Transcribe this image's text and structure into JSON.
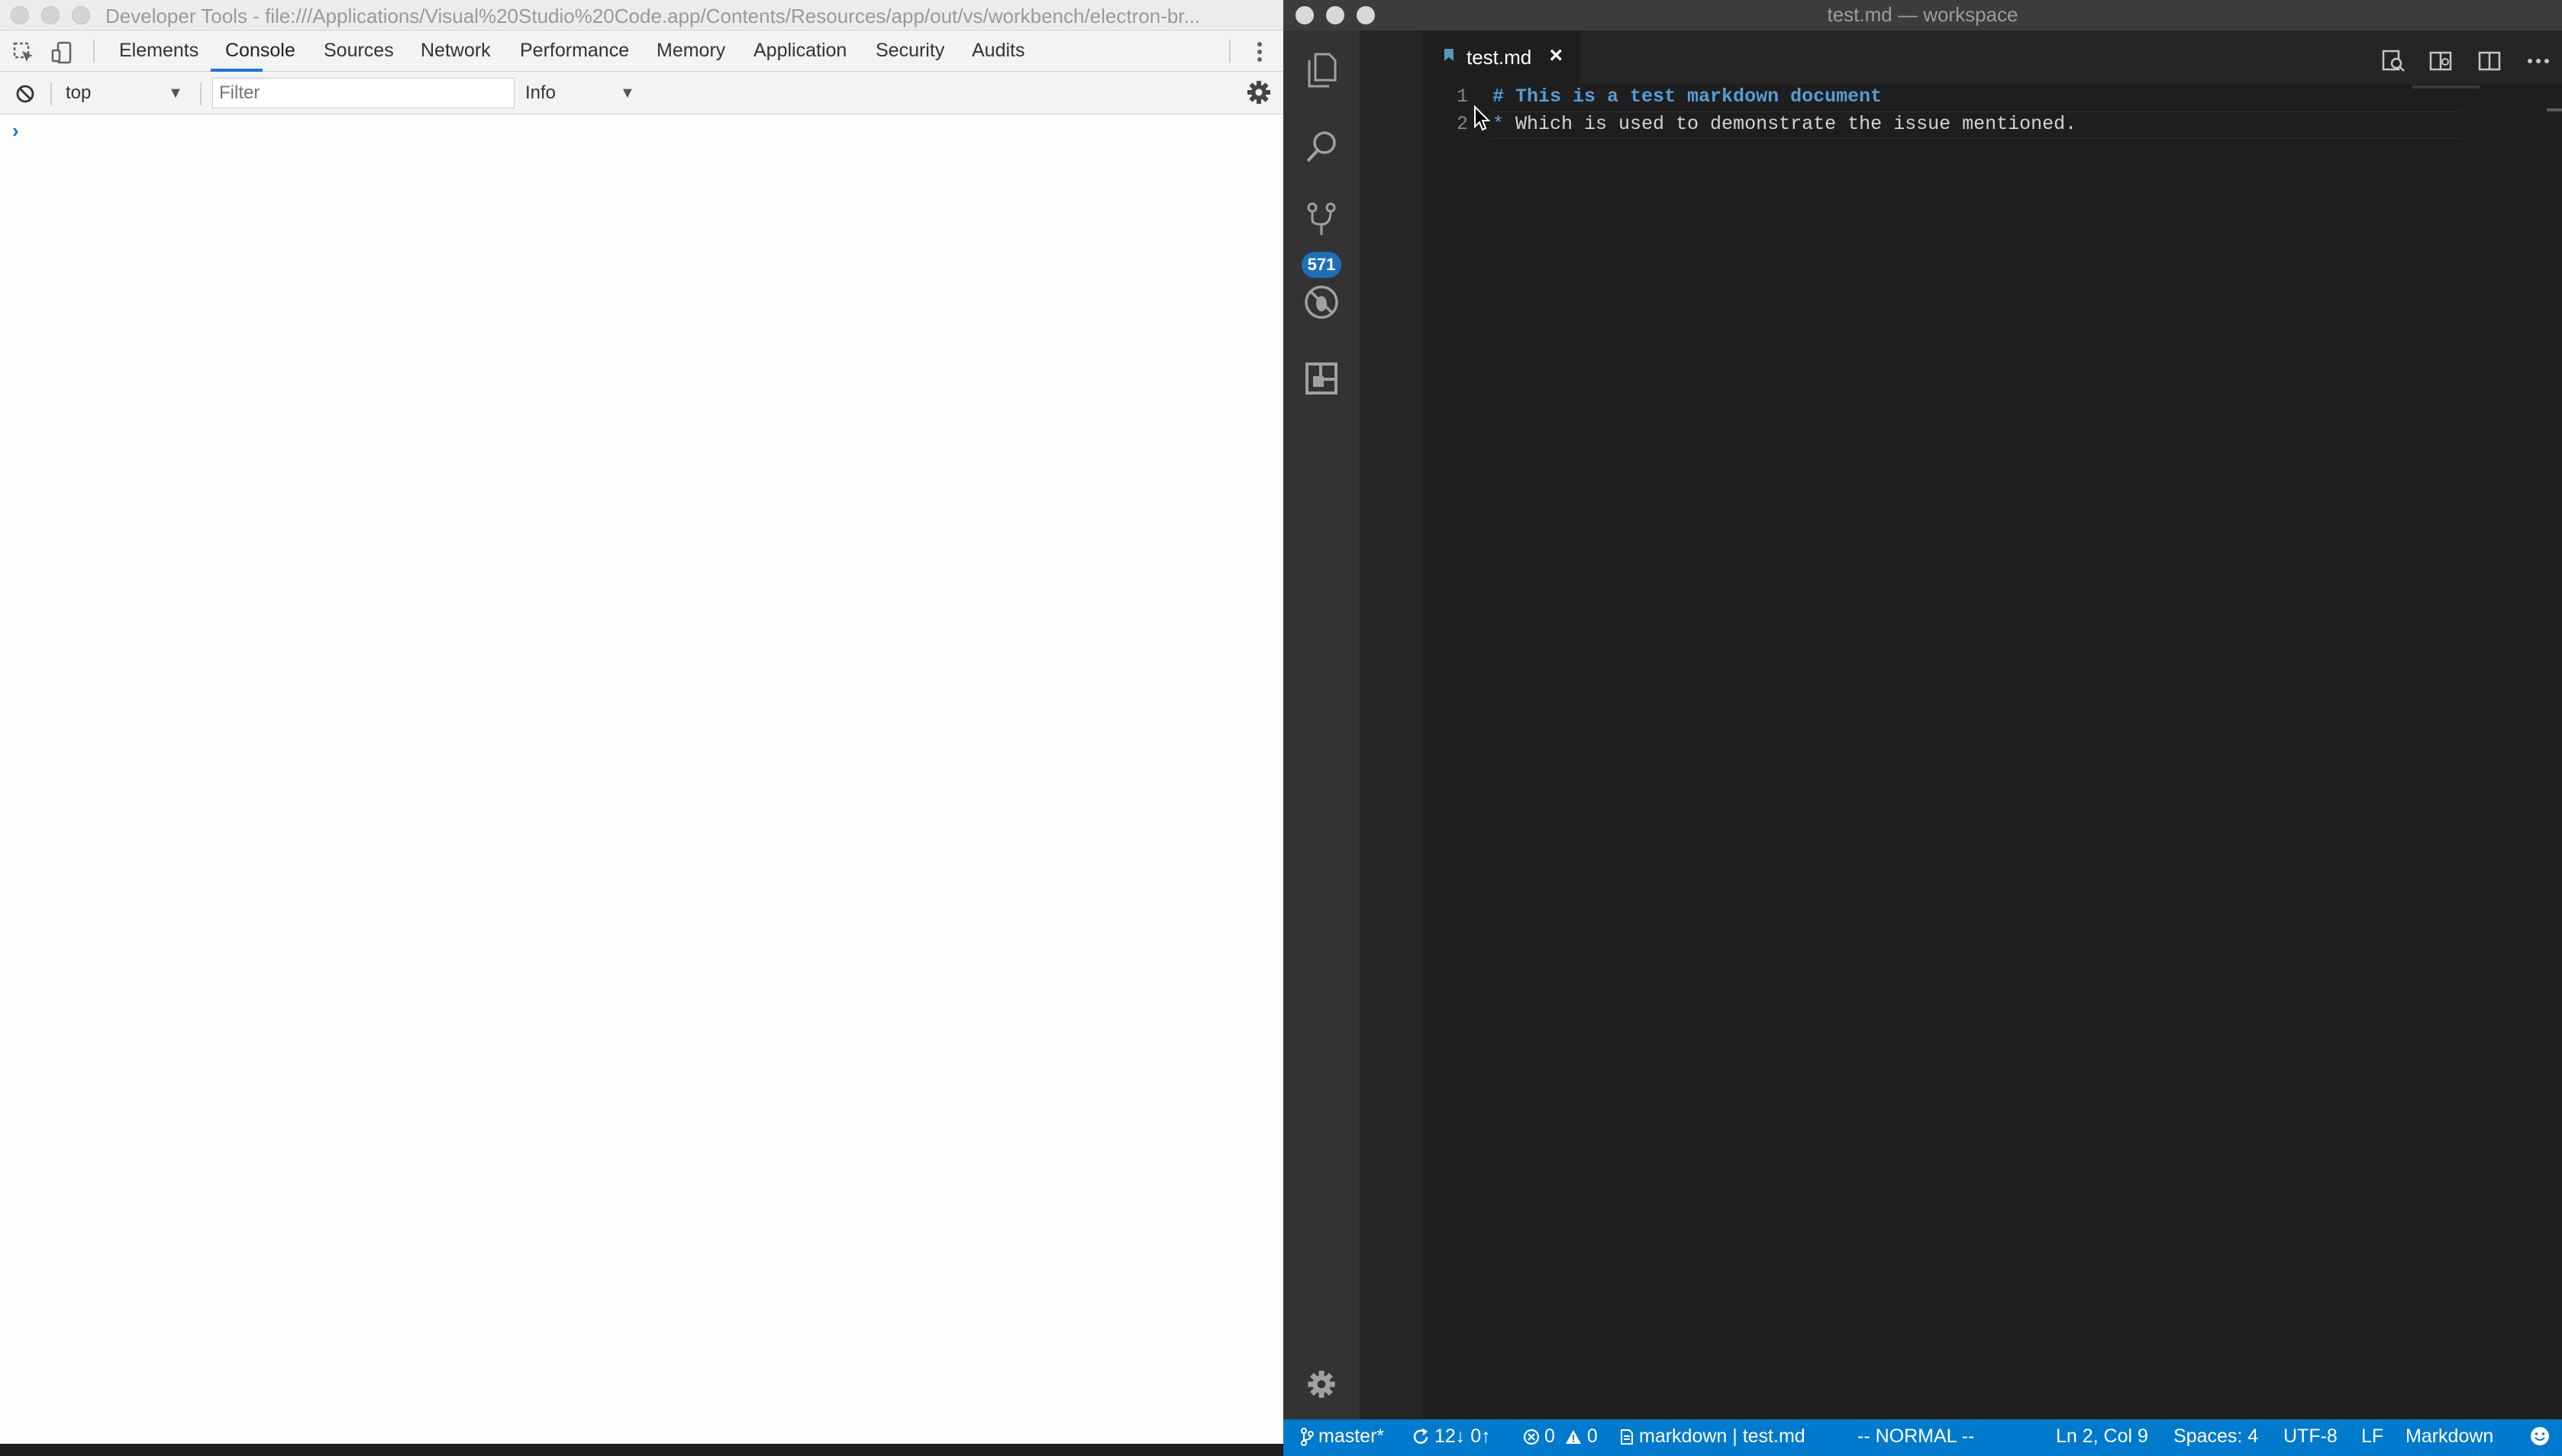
{
  "devtools": {
    "window_title": "Developer Tools - file:///Applications/Visual%20Studio%20Code.app/Contents/Resources/app/out/vs/workbench/electron-br...",
    "tabs": [
      "Elements",
      "Console",
      "Sources",
      "Network",
      "Performance",
      "Memory",
      "Application",
      "Security",
      "Audits"
    ],
    "active_tab": "Console",
    "context_select": "top",
    "filter_placeholder": "Filter",
    "level_select": "Info",
    "prompt": "›",
    "icons": [
      "inspect-element-icon",
      "device-toolbar-icon",
      "more-vertical-icon",
      "clear-console-icon",
      "gear-icon"
    ]
  },
  "vscode": {
    "window_title": "test.md — workspace",
    "tab": {
      "label": "test.md",
      "close": "×"
    },
    "scm_badge": "571",
    "editor_lines": [
      {
        "number": "1",
        "prefix": "# ",
        "text": "This is a test markdown document"
      },
      {
        "number": "2",
        "prefix": "* ",
        "text": "Which is used to demonstrate the issue mentioned."
      }
    ],
    "status": {
      "branch": "master*",
      "sync": "12↓ 0↑",
      "errors": "0",
      "warnings": "0",
      "breadcrumb": "markdown | test.md",
      "mode": "-- NORMAL --",
      "position": "Ln 2, Col 9",
      "spaces": "Spaces: 4",
      "encoding": "UTF-8",
      "eol": "LF",
      "language": "Markdown"
    },
    "accent": "#007acc"
  }
}
